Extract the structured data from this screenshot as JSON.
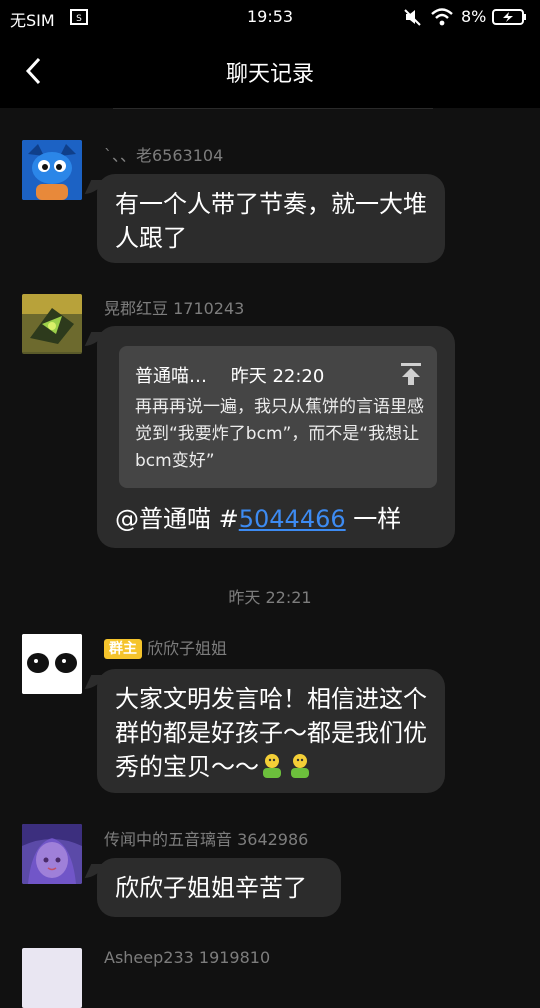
{
  "status_bar": {
    "carrier": "无SIM",
    "time": "19:53",
    "battery": "8%"
  },
  "nav": {
    "title": "聊天记录"
  },
  "messages": [
    {
      "sender": "`、、老6563104",
      "text": "有一个人带了节奏，就一大堆人跟了"
    },
    {
      "sender": "晃郡红豆 1710243",
      "quote": {
        "author": "普通喵…",
        "time": "昨天 22:20",
        "text": "再再再说一遍，我只从蕉饼的言语里感觉到“我要炸了bcm”，而不是“我想让bcm变好”"
      },
      "mention": "@普通喵 #",
      "link_text": "5044466",
      "suffix": " 一样"
    },
    {
      "timestamp": "昨天 22:21"
    },
    {
      "badge": "群主",
      "sender": "欣欣子姐姐",
      "text": "大家文明发言哈！相信进这个群的都是好孩子～都是我们优秀的宝贝～～"
    },
    {
      "sender": "传闻中的五音璃音 3642986",
      "text": "欣欣子姐姐辛苦了"
    },
    {
      "sender": "Asheep233 1919810"
    }
  ],
  "colors": {
    "background": "#111111",
    "bubble": "#2c2c2c",
    "quote_bg": "#454545",
    "link": "#3d8bf2",
    "badge": "#f5c42c",
    "meta_text": "#7d7d7d"
  }
}
